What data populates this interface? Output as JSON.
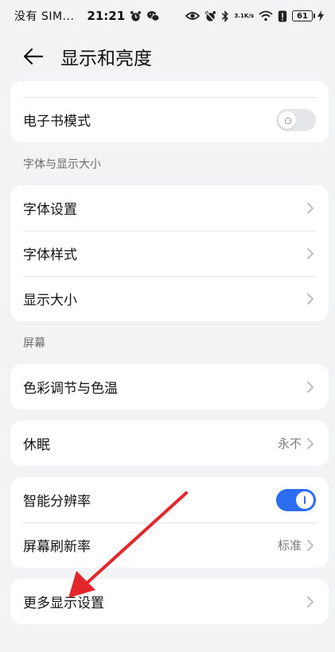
{
  "status_bar": {
    "carrier": "没有 SIM...",
    "time": "21:21",
    "net_speed_top": "3.1",
    "net_speed_bottom": "K/s",
    "battery": "61"
  },
  "header": {
    "title": "显示和亮度"
  },
  "top_card": {
    "items": [
      {
        "label": "电子书模式",
        "toggle": "off"
      }
    ]
  },
  "font_section": {
    "title": "字体与显示大小",
    "items": [
      {
        "label": "字体设置"
      },
      {
        "label": "字体样式"
      },
      {
        "label": "显示大小"
      }
    ]
  },
  "screen_section": {
    "title": "屏幕",
    "color_item": {
      "label": "色彩调节与色温"
    }
  },
  "sleep_card": {
    "label": "休眠",
    "value": "永不"
  },
  "resolution_card": {
    "items": [
      {
        "label": "智能分辨率",
        "toggle": "on"
      },
      {
        "label": "屏幕刷新率",
        "value": "标准"
      }
    ]
  },
  "more_card": {
    "label": "更多显示设置"
  },
  "colors": {
    "accent": "#2b6cf0",
    "arrow": "#e3262b",
    "background": "#f1f3f5"
  },
  "icons": [
    "back-arrow-icon",
    "chevron-right-icon",
    "alarm-icon",
    "wechat-icon",
    "eye-icon",
    "bluetooth-icon",
    "wifi-icon",
    "battery-icon"
  ]
}
